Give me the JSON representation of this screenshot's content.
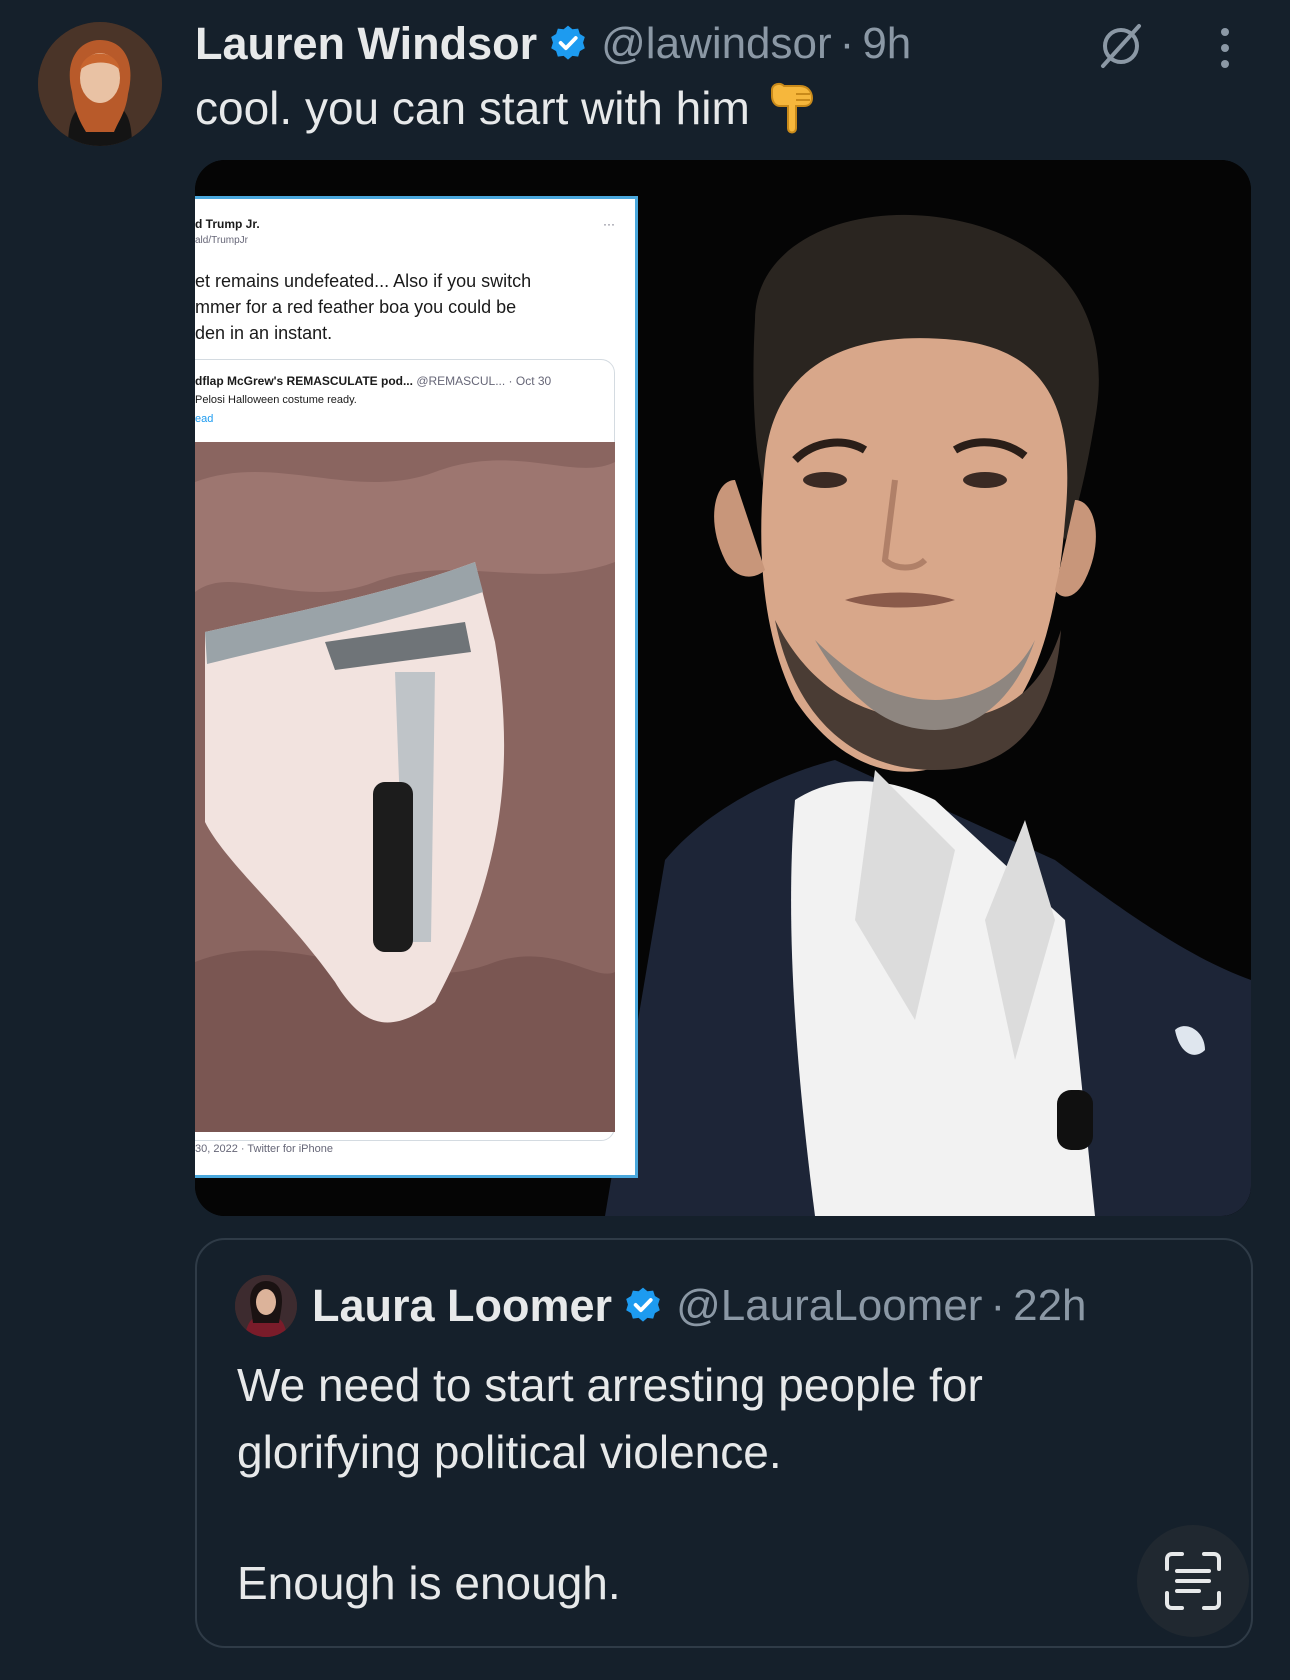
{
  "tweet": {
    "author_name": "Lauren Windsor",
    "handle": "@lawindsor",
    "separator": "·",
    "time": "9h",
    "text": "cool. you can start with him",
    "emoji": "backhand-index-pointing-down-emoji",
    "icons": {
      "grok": "grok-icon",
      "more": "more-vertical-icon",
      "verified": "verified-badge-icon"
    }
  },
  "embedded_screenshot": {
    "author_name": "d Trump Jr.",
    "handle": "ald/TrumpJr",
    "more": "···",
    "lines": [
      "et remains undefeated... Also if you switch",
      "mmer for a red feather boa you could be",
      "den in an instant."
    ],
    "quoted_author": "dflap McGrew's REMASCULATE pod...",
    "quoted_handle": "@REMASCUL...",
    "quoted_date": "· Oct 30",
    "quoted_line": "Pelosi Halloween costume ready.",
    "quoted_link": "ead",
    "footer": "30, 2022 · Twitter for iPhone"
  },
  "quote": {
    "author_name": "Laura Loomer",
    "handle": "@LauraLoomer",
    "separator": "·",
    "time": "22h",
    "paragraph1_line1": "We need to start arresting people for",
    "paragraph1_line2": "glorifying political violence.",
    "paragraph2": "Enough is enough.",
    "translate_icon": "scan-text-icon"
  },
  "colors": {
    "background": "#15202b",
    "text": "#e7e9ea",
    "secondary": "#8b98a5",
    "verified": "#1d9bf0",
    "border": "#2f3b47"
  }
}
